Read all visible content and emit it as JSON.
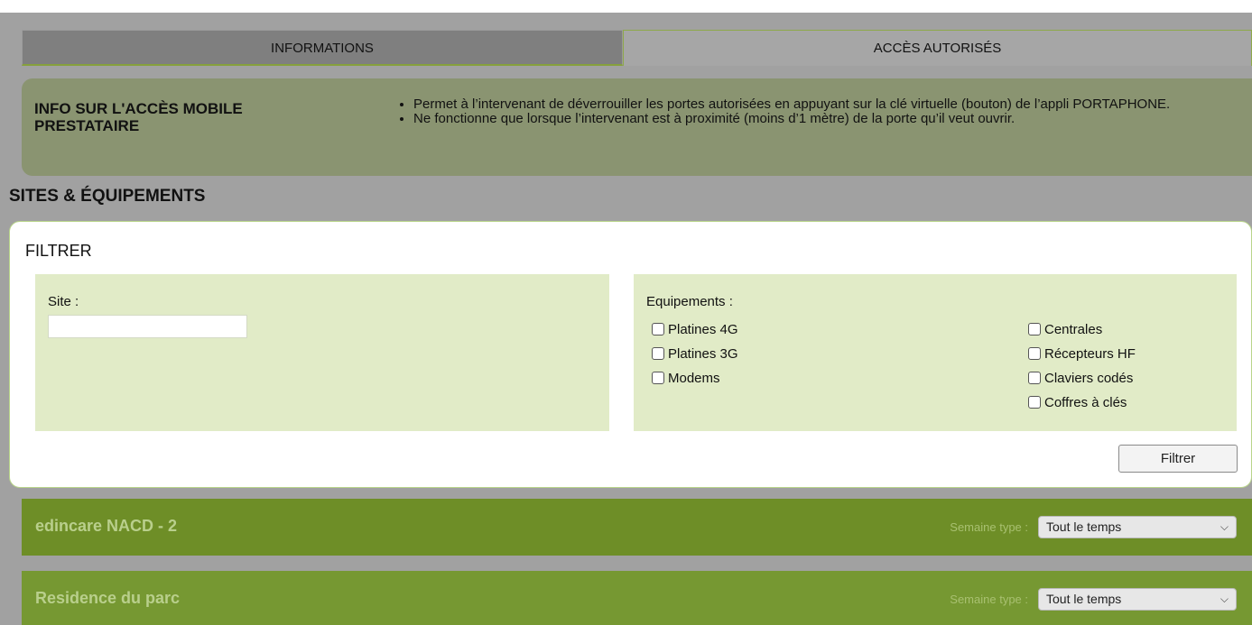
{
  "tabs": {
    "informations": "INFORMATIONS",
    "acces": "ACCÈS AUTORISÉS"
  },
  "info": {
    "title": "INFO SUR L'ACCÈS MOBILE PRESTATAIRE",
    "bullets": [
      "Permet à l’intervenant de déverrouiller les portes autorisées en appuyant sur la clé virtuelle (bouton) de l’appli PORTAPHONE.",
      "Ne fonctionne que lorsque l’intervenant est à proximité (moins d’1 mètre) de la porte qu’il veut ouvrir."
    ]
  },
  "section_title": "SITES & ÉQUIPEMENTS",
  "filter": {
    "title": "FILTRER",
    "site_label": "Site :",
    "site_value": "",
    "equipements_label": "Equipements :",
    "checkboxes_left": [
      "Platines 4G",
      "Platines 3G",
      "Modems"
    ],
    "checkboxes_right": [
      "Centrales",
      "Récepteurs HF",
      "Claviers codés",
      "Coffres à clés"
    ],
    "button": "Filtrer"
  },
  "sites": [
    {
      "name": "edincare NACD - 2",
      "semaine_label": "Semaine type :",
      "semaine_value": "Tout le temps"
    },
    {
      "name": "Residence du parc",
      "semaine_label": "Semaine type :",
      "semaine_value": "Tout le temps"
    }
  ],
  "icons": {
    "select_chevron": "chevron-down-icon"
  }
}
